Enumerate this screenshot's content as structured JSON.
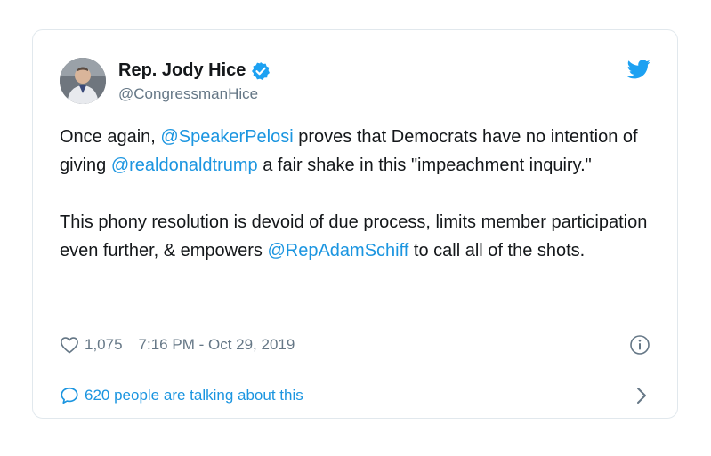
{
  "author": {
    "display_name": "Rep. Jody Hice",
    "handle": "@CongressmanHice",
    "verified": true
  },
  "tweet": {
    "p1_pre": "Once again, ",
    "p1_mention1": "@SpeakerPelosi",
    "p1_mid": " proves that Democrats have no intention of giving ",
    "p1_mention2": "@realdonaldtrump",
    "p1_post": " a fair shake in this \"impeachment inquiry.\"",
    "p2_pre": "This phony resolution is devoid of due process, limits member participation even further, & empowers ",
    "p2_mention": "@RepAdamSchiff",
    "p2_post": " to call all of the shots."
  },
  "meta": {
    "likes": "1,075",
    "timestamp": "7:16 PM - Oct 29, 2019"
  },
  "footer": {
    "talking": "620 people are talking about this"
  },
  "icons": {
    "avatar": "avatar",
    "verified": "verified-badge-icon",
    "brand": "twitter-bird-icon",
    "like": "heart-icon",
    "info": "info-icon",
    "reply": "speech-bubble-icon",
    "more": "chevron-right-icon"
  },
  "colors": {
    "link": "#1b95e0",
    "muted": "#657786",
    "text": "#14171a",
    "border": "#e1e8ed"
  }
}
